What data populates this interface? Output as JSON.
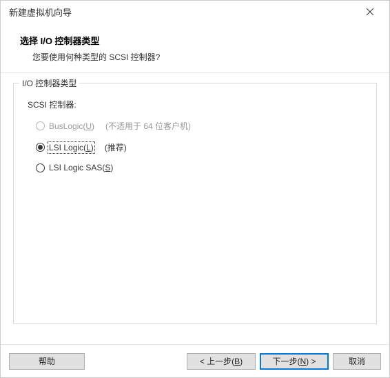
{
  "window": {
    "title": "新建虚拟机向导"
  },
  "header": {
    "heading": "选择 I/O 控制器类型",
    "subheading": "您要使用何种类型的 SCSI 控制器?"
  },
  "group": {
    "legend": "I/O 控制器类型",
    "field_label": "SCSI 控制器:",
    "options": [
      {
        "label_pre": "BusLogic(",
        "accel": "U",
        "label_post": ")",
        "note": "(不适用于 64 位客户机)",
        "disabled": true,
        "selected": false
      },
      {
        "label_pre": "LSI Logic(",
        "accel": "L",
        "label_post": ")",
        "note": "(推荐)",
        "disabled": false,
        "selected": true
      },
      {
        "label_pre": "LSI Logic SAS(",
        "accel": "S",
        "label_post": ")",
        "note": "",
        "disabled": false,
        "selected": false
      }
    ]
  },
  "footer": {
    "help": "帮助",
    "back_pre": "< 上一步(",
    "back_accel": "B",
    "back_post": ")",
    "next_pre": "下一步(",
    "next_accel": "N",
    "next_post": ") >",
    "cancel": "取消"
  }
}
